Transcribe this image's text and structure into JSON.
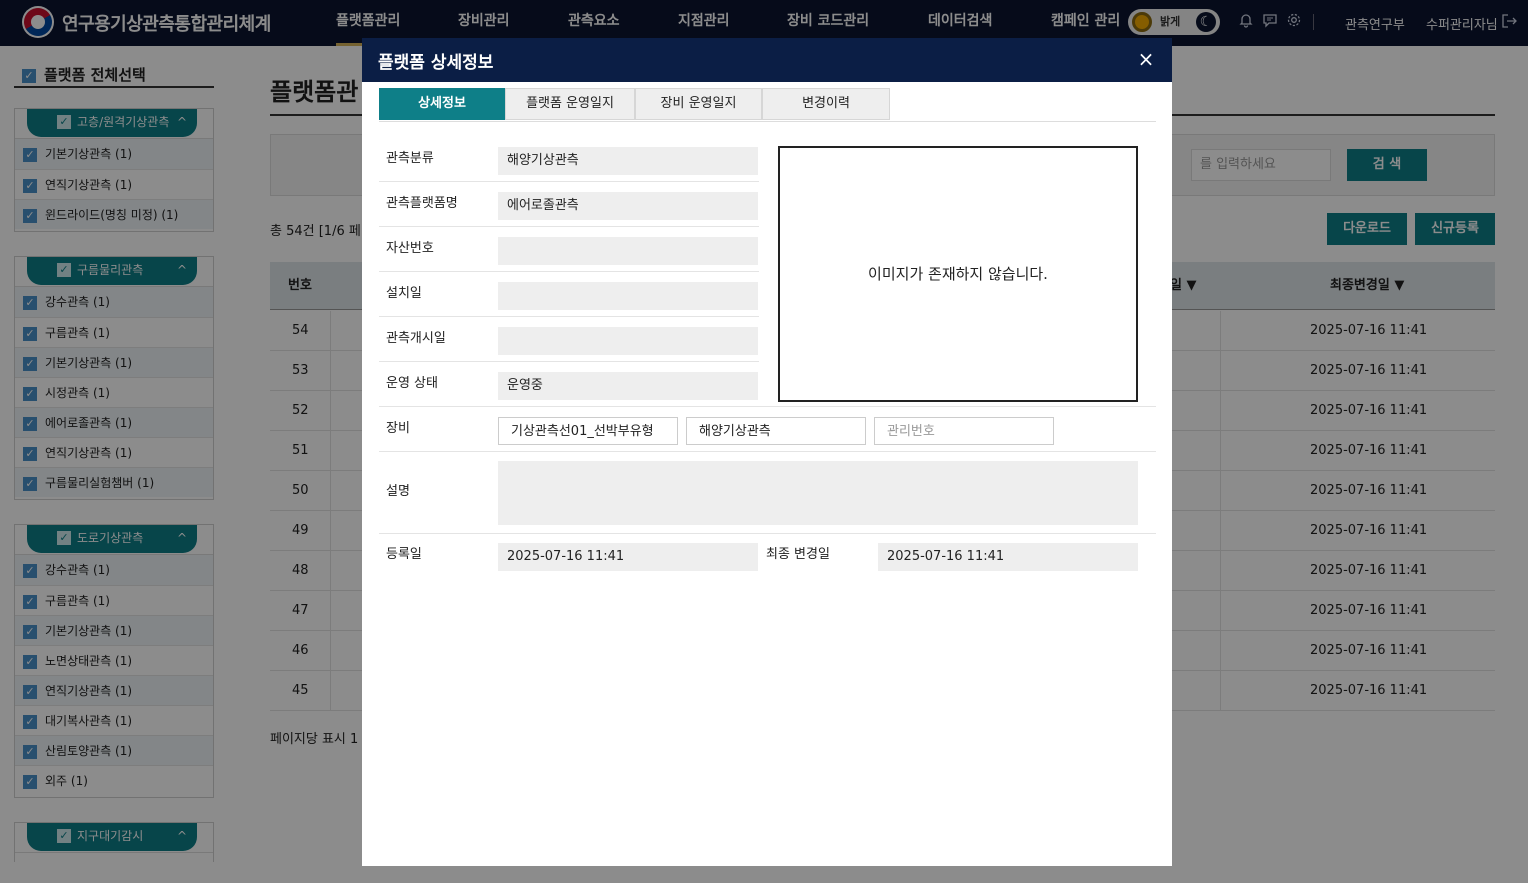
{
  "header": {
    "brand": "연구용기상관측통합관리체계",
    "nav": [
      "플랫폼관리",
      "장비관리",
      "관측요소",
      "지점관리",
      "장비 코드관리",
      "데이터검색",
      "캠페인 관리"
    ],
    "theme_label": "밝게",
    "org": "관측연구부",
    "user": "수퍼관리자님",
    "colors": {
      "topbar": "#0b1530",
      "active_underline": "#d6b35a",
      "accent": "#0e7f88"
    },
    "icons": [
      "bell-icon",
      "chat-icon",
      "gear-icon",
      "logout-icon"
    ]
  },
  "sidebar": {
    "select_all": "플랫폼 전체선택",
    "groups": [
      {
        "title": "고층/원격기상관측",
        "items": [
          "기본기상관측 (1)",
          "연직기상관측 (1)",
          "윈드라이드(명칭 미정) (1)"
        ]
      },
      {
        "title": "구름물리관측",
        "items": [
          "강수관측 (1)",
          "구름관측 (1)",
          "기본기상관측 (1)",
          "시정관측 (1)",
          "에어로졸관측 (1)",
          "연직기상관측 (1)",
          "구름물리실험챔버 (1)"
        ]
      },
      {
        "title": "도로기상관측",
        "items": [
          "강수관측 (1)",
          "구름관측 (1)",
          "기본기상관측 (1)",
          "노면상태관측 (1)",
          "연직기상관측 (1)",
          "대기복사관측 (1)",
          "산림토양관측 (1)",
          "외주 (1)"
        ]
      },
      {
        "title": "지구대기감시",
        "items": []
      }
    ]
  },
  "main": {
    "title": "플랫폼관",
    "search_placeholder": "를 입력하세요",
    "search_btn": "검 색",
    "total": "총 54건 [1/6 페",
    "download_btn": "다운로드",
    "register_btn": "신규등록",
    "col_no": "번호",
    "col_reg": "일 ▼",
    "col_last": "최종변경일 ▼",
    "rows": [
      {
        "no": "54",
        "date": "2025-07-16 11:41"
      },
      {
        "no": "53",
        "date": "2025-07-16 11:41"
      },
      {
        "no": "52",
        "date": "2025-07-16 11:41"
      },
      {
        "no": "51",
        "date": "2025-07-16 11:41"
      },
      {
        "no": "50",
        "date": "2025-07-16 11:41"
      },
      {
        "no": "49",
        "date": "2025-07-16 11:41"
      },
      {
        "no": "48",
        "date": "2025-07-16 11:41"
      },
      {
        "no": "47",
        "date": "2025-07-16 11:41"
      },
      {
        "no": "46",
        "date": "2025-07-16 11:41"
      },
      {
        "no": "45",
        "date": "2025-07-16 11:41"
      }
    ],
    "per_page": "페이지당 표시 1"
  },
  "modal": {
    "title": "플랫폼 상세정보",
    "close": "×",
    "tabs": [
      "상세정보",
      "플랫폼 운영일지",
      "장비 운영일지",
      "변경이력"
    ],
    "fields": {
      "category_label": "관측분류",
      "category": "해양기상관측",
      "name_label": "관측플랫폼명",
      "name": "에어로졸관측",
      "asset_label": "자산번호",
      "asset": "",
      "install_label": "설치일",
      "install": "",
      "start_label": "관측개시일",
      "start": "",
      "status_label": "운영 상태",
      "status": "운영중",
      "equip_label": "장비",
      "equip_name": "기상관측선01_선박부유형",
      "equip_type": "해양기상관측",
      "equip_mgmt_placeholder": "관리번호",
      "desc_label": "설명",
      "desc": "",
      "reg_label": "등록일",
      "reg": "2025-07-16 11:41",
      "last_label": "최종 변경일",
      "last": "2025-07-16 11:41"
    },
    "image_msg": "이미지가 존재하지 않습니다."
  }
}
